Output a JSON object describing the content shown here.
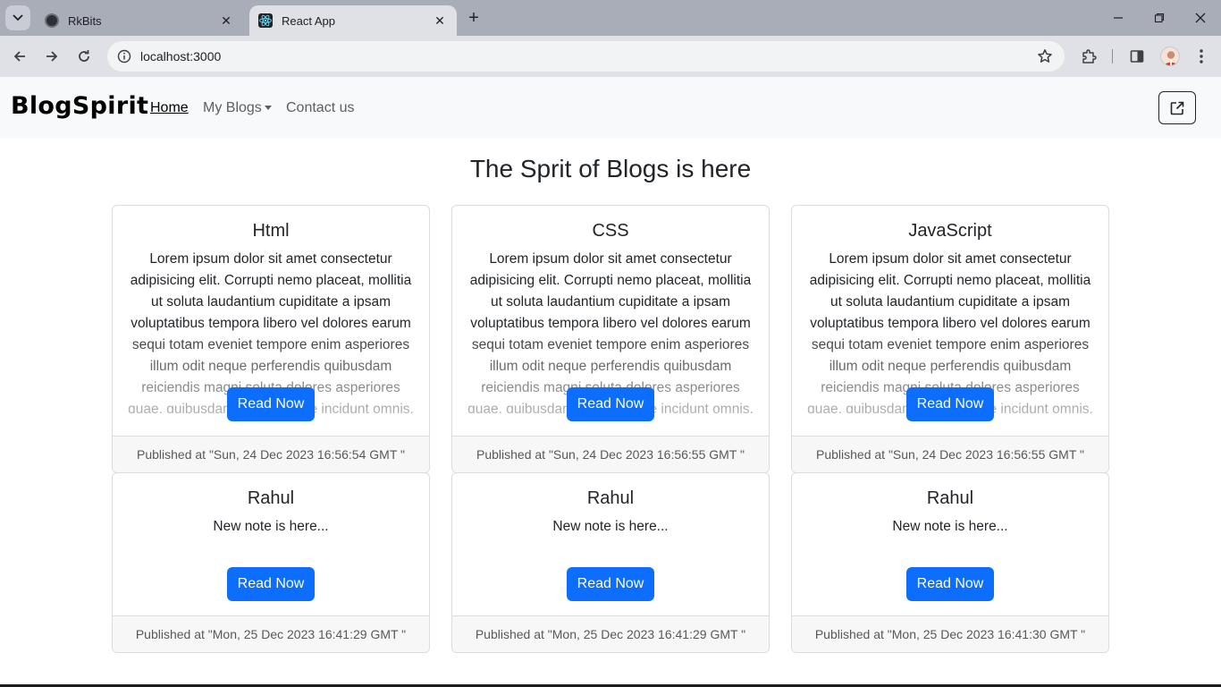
{
  "browser": {
    "tabs": [
      {
        "title": "RkBits",
        "active": false
      },
      {
        "title": "React App",
        "active": true
      }
    ],
    "url": "localhost:3000",
    "icons": [
      "tab-search-icon",
      "close-icon",
      "new-tab-icon",
      "minimize-icon",
      "restore-icon",
      "close-window-icon",
      "back-icon",
      "forward-icon",
      "reload-icon",
      "site-info-icon",
      "bookmark-star-icon",
      "extensions-icon",
      "side-panel-icon",
      "profile-avatar",
      "menu-icon"
    ]
  },
  "navbar": {
    "brand": "BlogSpirit",
    "links": [
      {
        "label": "Home",
        "active": true
      },
      {
        "label": "My Blogs",
        "dropdown": true
      },
      {
        "label": "Contact us"
      }
    ],
    "action_icon": "external-link-icon"
  },
  "main": {
    "heading": "The Sprit of Blogs is here",
    "cards": [
      {
        "title": "Html",
        "text": "Lorem ipsum dolor sit amet consectetur adipisicing elit. Corrupti nemo placeat, mollitia ut soluta laudantium cupiditate a ipsam voluptatibus tempora libero vel dolores earum sequi totam eveniet tempore enim asperiores illum odit neque perferendis quibusdam reiciendis magni soluta dolores asperiores quae, quibusdam ullam ratione incidunt omnis.",
        "button": "Read Now",
        "footer": "Published at \"Sun, 24 Dec 2023 16:56:54 GMT \""
      },
      {
        "title": "CSS",
        "text": "Lorem ipsum dolor sit amet consectetur adipisicing elit. Corrupti nemo placeat, mollitia ut soluta laudantium cupiditate a ipsam voluptatibus tempora libero vel dolores earum sequi totam eveniet tempore enim asperiores illum odit neque perferendis quibusdam reiciendis magni soluta dolores asperiores quae, quibusdam ullam ratione incidunt omnis.",
        "button": "Read Now",
        "footer": "Published at \"Sun, 24 Dec 2023 16:56:55 GMT \""
      },
      {
        "title": "JavaScript",
        "text": "Lorem ipsum dolor sit amet consectetur adipisicing elit. Corrupti nemo placeat, mollitia ut soluta laudantium cupiditate a ipsam voluptatibus tempora libero vel dolores earum sequi totam eveniet tempore enim asperiores illum odit neque perferendis quibusdam reiciendis magni soluta dolores asperiores quae, quibusdam ullam ratione incidunt omnis.",
        "button": "Read Now",
        "footer": "Published at \"Sun, 24 Dec 2023 16:56:55 GMT \""
      },
      {
        "title": "Rahul",
        "text": "New note is here...",
        "button": "Read Now",
        "footer": "Published at \"Mon, 25 Dec 2023 16:41:29 GMT \""
      },
      {
        "title": "Rahul",
        "text": "New note is here...",
        "button": "Read Now",
        "footer": "Published at \"Mon, 25 Dec 2023 16:41:29 GMT \""
      },
      {
        "title": "Rahul",
        "text": "New note is here...",
        "button": "Read Now",
        "footer": "Published at \"Mon, 25 Dec 2023 16:41:30 GMT \""
      }
    ]
  },
  "colors": {
    "primary": "#0d6efd",
    "navbar_bg": "#f8f9fa",
    "tab_strip": "#a9adb8",
    "toolbar": "#dfe1e6"
  }
}
